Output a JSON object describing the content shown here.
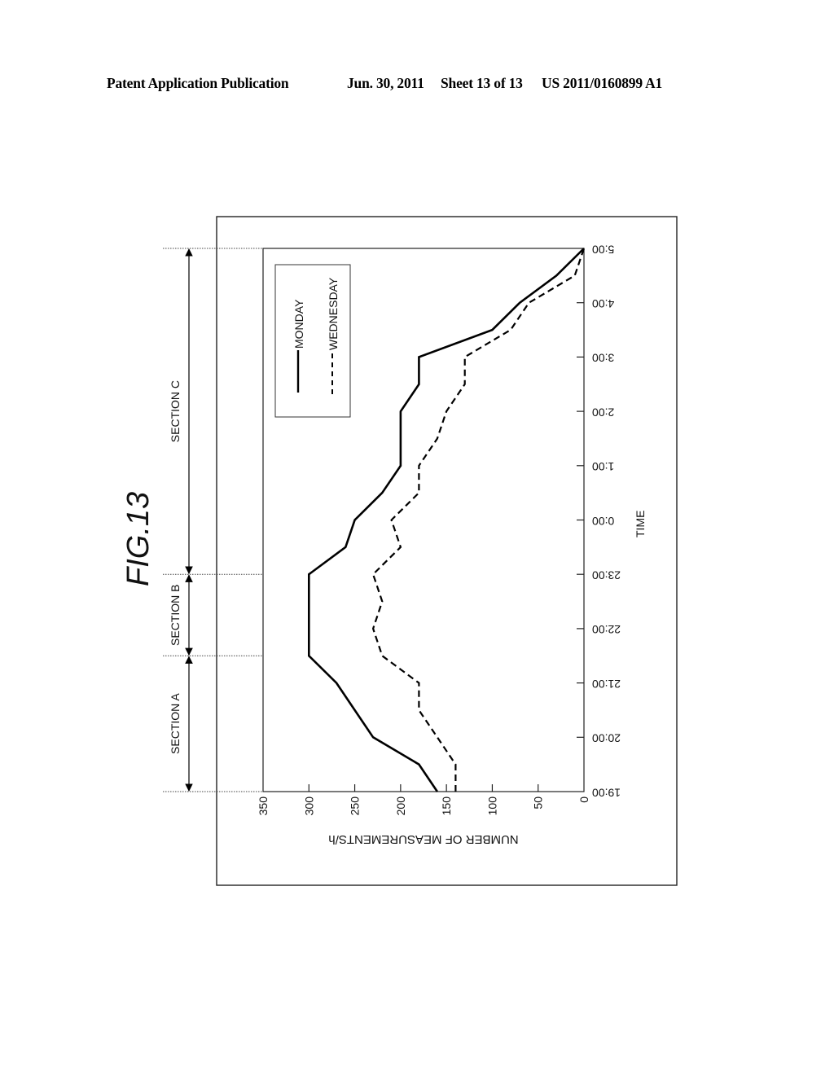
{
  "header": {
    "title": "Patent Application Publication",
    "date": "Jun. 30, 2011",
    "sheet": "Sheet 13 of 13",
    "number": "US 2011/0160899 A1"
  },
  "figure": {
    "label": "FIG.13",
    "orientation": "rotated 90° (page landscape)"
  },
  "sections": [
    {
      "label": "SECTION A",
      "from": "19:00",
      "to": "21:30"
    },
    {
      "label": "SECTION B",
      "from": "21:30",
      "to": "23:00"
    },
    {
      "label": "SECTION C",
      "from": "23:00",
      "to": "5:00"
    }
  ],
  "chart_data": {
    "type": "line",
    "title": "FIG.13",
    "xlabel": "TIME",
    "ylabel": "NUMBER OF MEASUREMENTS/h",
    "x": [
      "19:00",
      "19:30",
      "20:00",
      "20:30",
      "21:00",
      "21:30",
      "22:00",
      "22:30",
      "23:00",
      "23:30",
      "0:00",
      "0:30",
      "1:00",
      "1:30",
      "2:00",
      "2:30",
      "3:00",
      "3:30",
      "4:00",
      "4:30",
      "5:00"
    ],
    "x_tick_labels": [
      "19:00",
      "20:00",
      "21:00",
      "22:00",
      "23:00",
      "0:00",
      "1:00",
      "2:00",
      "3:00",
      "4:00",
      "5:00"
    ],
    "y_tick_labels": [
      "0",
      "50",
      "100",
      "150",
      "200",
      "250",
      "300",
      "350"
    ],
    "ylim": [
      0,
      350
    ],
    "grid": false,
    "legend_position": "top-left",
    "series": [
      {
        "name": "MONDAY",
        "style": "solid",
        "values": [
          160,
          180,
          230,
          250,
          270,
          300,
          300,
          300,
          300,
          260,
          250,
          220,
          200,
          200,
          200,
          180,
          180,
          100,
          70,
          30,
          0
        ]
      },
      {
        "name": "WEDNESDAY",
        "style": "dashed",
        "values": [
          140,
          140,
          160,
          180,
          180,
          220,
          230,
          220,
          230,
          200,
          210,
          180,
          180,
          160,
          150,
          130,
          130,
          80,
          60,
          10,
          0
        ]
      }
    ]
  }
}
